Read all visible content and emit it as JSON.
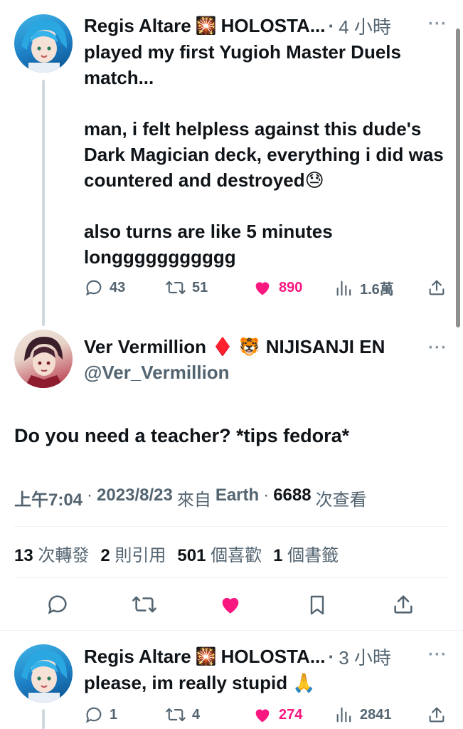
{
  "colors": {
    "like": "#f91880",
    "text": "#0f1419",
    "muted": "#536471"
  },
  "reply1": {
    "author": "Regis Altare",
    "badge_icon": "fireworks-emoji",
    "badge_emoji": "🎇",
    "org": "HOLOSTA...",
    "dot": "·",
    "time": "4 小時",
    "more": "···",
    "text": "played my first Yugioh Master Duels match...\n\nman, i felt helpless against this dude's Dark Magician deck, everything i did was countered and destroyed😓\n\nalso turns are like 5 minutes longgggggggggg",
    "replies": "43",
    "retweets": "51",
    "likes": "890",
    "views": "1.6萬"
  },
  "main": {
    "author": "Ver Vermillion",
    "badge1_emoji": "♦️",
    "badge2_emoji": "🐯",
    "org": "NIJISANJI EN",
    "handle": "@Ver_Vermillion",
    "more": "···",
    "text": "Do you need a teacher? *tips fedora*",
    "time": "上午7:04",
    "dot1": "·",
    "date": "2023/8/23",
    "source_prefix": "來自",
    "source": "Earth",
    "dot2": "·",
    "views_num": "6688",
    "views_label": "次查看",
    "stats": [
      {
        "num": "13",
        "label": "次轉發"
      },
      {
        "num": "2",
        "label": "則引用"
      },
      {
        "num": "501",
        "label": "個喜歡"
      },
      {
        "num": "1",
        "label": "個書籤"
      }
    ]
  },
  "reply2": {
    "author": "Regis Altare",
    "badge_emoji": "🎇",
    "org": "HOLOSTA...",
    "dot": "·",
    "time": "3 小時",
    "more": "···",
    "text": "please, im really stupid 🙏",
    "replies": "1",
    "retweets": "4",
    "likes": "274",
    "views": "2841"
  }
}
